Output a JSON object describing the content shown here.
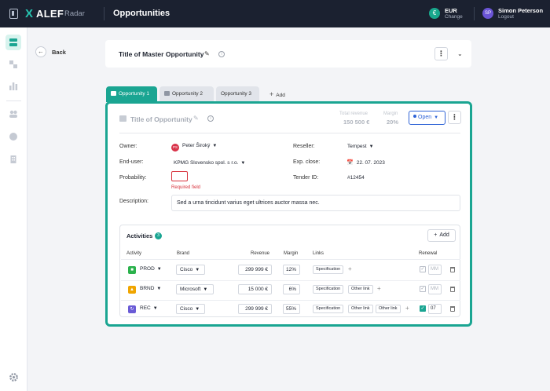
{
  "brand": {
    "x": "X",
    "name": "ALEF",
    "product": "Radar"
  },
  "header": {
    "title": "Opportunities"
  },
  "currency": {
    "symbol": "€",
    "code": "EUR",
    "action": "Change"
  },
  "user": {
    "initials": "SP",
    "name": "Simon Peterson",
    "action": "Logout"
  },
  "nav": {
    "back": "Back"
  },
  "master": {
    "title": "Title of Master Opportunity"
  },
  "tabs": [
    {
      "label": "Opportunity 1"
    },
    {
      "label": "Opportunity 2"
    },
    {
      "label": "Opportunity 3"
    }
  ],
  "add_tab": "Add",
  "opportunity": {
    "title": "Title of Opportunity",
    "total_revenue_label": "Total revenue",
    "total_revenue_value": "150 500 €",
    "margin_label": "Margin",
    "margin_value": "20%",
    "status": "Open"
  },
  "form": {
    "owner_label": "Owner:",
    "owner_initials": "PS",
    "owner_value": "Peter Široký",
    "enduser_label": "End-user:",
    "enduser_value": "KPMG Slovensko spol. s r.o.",
    "probability_label": "Probability:",
    "probability_error": "Required field",
    "reseller_label": "Reseller:",
    "reseller_value": "Tempest",
    "exp_close_label": "Exp. close:",
    "exp_close_value": "22. 07. 2023",
    "tender_label": "Tender ID:",
    "tender_value": "#12454",
    "description_label": "Description:",
    "description_value": "Sed a urna tincidunt varius eget ultrices auctor massa nec."
  },
  "activities": {
    "title": "Activities",
    "count": "3",
    "add_label": "Add",
    "columns": [
      "Activity",
      "Brand",
      "Revenue",
      "Margin",
      "Links",
      "Renewal"
    ],
    "rows": [
      {
        "activity": "PROD",
        "icon_color": "#2bb24c",
        "brand": "Cisco",
        "revenue": "299 999 €",
        "margin": "12%",
        "links": [
          "Specification"
        ],
        "renewal_checked": false,
        "renewal_value": "MM"
      },
      {
        "activity": "BRND",
        "icon_color": "#f0a500",
        "brand": "Microsoft",
        "revenue": "15 000 €",
        "margin": "6%",
        "links": [
          "Specification",
          "Other link"
        ],
        "renewal_checked": false,
        "renewal_value": "MM"
      },
      {
        "activity": "REC",
        "icon_color": "#6a5bd6",
        "brand": "Cisco",
        "revenue": "299 999 €",
        "margin": "55%",
        "links": [
          "Specification",
          "Other link",
          "Other link"
        ],
        "renewal_checked": true,
        "renewal_value": "07"
      }
    ]
  },
  "colors": {
    "accent": "#1aa592",
    "topbar": "#1b2130",
    "error": "#d7333d",
    "status": "#2e63d6"
  }
}
